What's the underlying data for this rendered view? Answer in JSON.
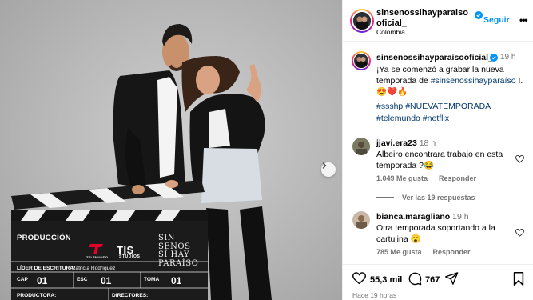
{
  "post": {
    "clapperboard": {
      "production_label": "PRODUCCIÓN",
      "writer_label": "LÍDER DE ESCRITURA:",
      "writer_name": "Patricia Rodríguez",
      "cap_label": "CAP",
      "cap_value": "01",
      "esc_label": "ESC",
      "esc_value": "01",
      "toma_label": "TOMA",
      "toma_value": "01",
      "producer_label": "PRODUCTORA:",
      "director_label": "DIRECTORES:",
      "telemundo_label": "TELEMUNDO",
      "tis_label": "TIS",
      "tis_sub": "STUDIOS",
      "show_title_lines": [
        "SIN",
        "SENOS",
        "SÍ HAY",
        "PARAÍSO"
      ]
    }
  },
  "header": {
    "username": "sinsenossihayparaisooficial_",
    "location": "Colombia",
    "follow_label": "Seguir",
    "more_label": "•••"
  },
  "caption": {
    "username": "sinsenossihayparaisooficial_",
    "time": "19 h",
    "text_before": "¡Ya se comenzó a grabar la nueva temporada de ",
    "hashtag_inline": "#sinsenossihayparaíso",
    "text_after": " !.",
    "emojis": "😍❤️🔥",
    "hashtags": [
      "#ssshp",
      "#NUEVATEMPORADA",
      "#telemundo",
      "#netflix"
    ]
  },
  "comments": [
    {
      "username": "jjavi.era23",
      "time": "18 h",
      "text": "Albeiro encontrara trabajo en esta temporada ?😂",
      "likes": "1.049 Me gusta",
      "reply": "Responder",
      "view_replies": "Ver las 19 respuestas"
    },
    {
      "username": "bianca.maragliano",
      "time": "19 h",
      "text": "Otra temporada soportando a la cartulina 😮",
      "likes": "785 Me gusta",
      "reply": "Responder"
    }
  ],
  "actions": {
    "likes_count": "55,3 mil",
    "comments_count": "767",
    "posted_ago": "Hace 19 horas"
  },
  "colors": {
    "accent": "#0095f6",
    "hashtag": "#00376b",
    "muted": "#737373",
    "verified": "#0095f6"
  }
}
